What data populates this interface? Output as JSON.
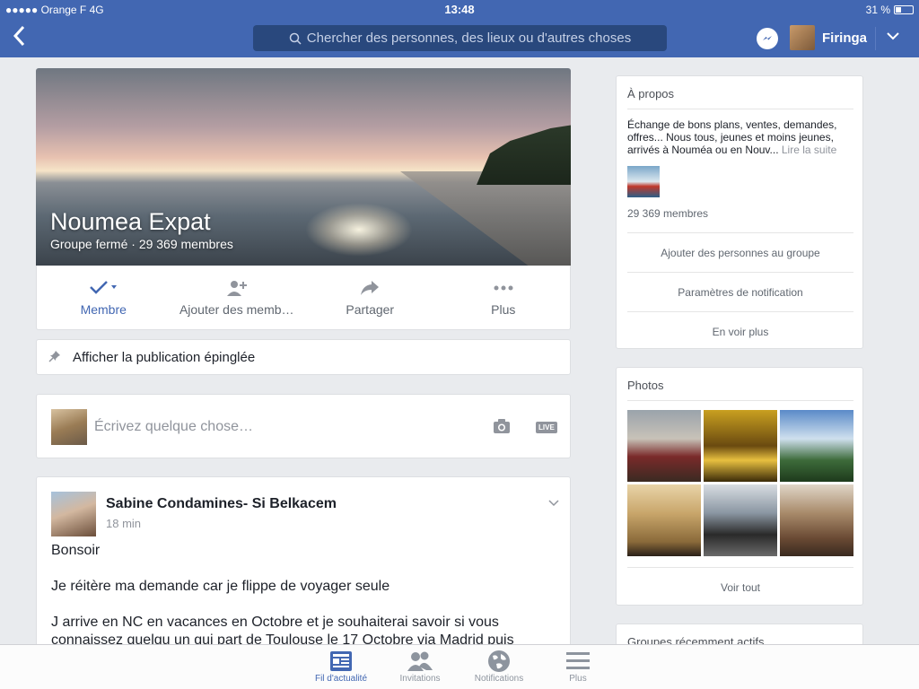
{
  "status": {
    "carrier": "●●●●● Orange F  4G",
    "time": "13:48",
    "battery": "31 %"
  },
  "header": {
    "search_placeholder": "Chercher des personnes, des lieux ou d'autres choses",
    "username": "Firinga"
  },
  "group": {
    "name": "Noumea Expat",
    "subtitle": "Groupe fermé · 29 369 membres",
    "actions": [
      {
        "label": "Membre",
        "icon": "check-icon",
        "active": true
      },
      {
        "label": "Ajouter des memb…",
        "icon": "add-person-icon"
      },
      {
        "label": "Partager",
        "icon": "share-icon"
      },
      {
        "label": "Plus",
        "icon": "more-icon"
      }
    ],
    "pinned_label": "Afficher la publication épinglée",
    "composer_placeholder": "Écrivez quelque chose…",
    "live_label": "LIVE"
  },
  "post": {
    "author": "Sabine Condamines- Si Belkacem",
    "time": "18 min",
    "paragraphs": [
      "Bonsoir",
      "Je réitère ma demande car je flippe de voyager seule",
      "J arrive en NC en vacances en Octobre et je souhaiterai savoir si vous connaissez quelqu un qui part de Toulouse le 17 Octobre via Madrid puis"
    ]
  },
  "about": {
    "heading": "À propos",
    "description": "Échange de bons plans, ventes, demandes, offres... Nous tous, jeunes et moins jeunes, arrivés à Nouméa ou en Nouv...",
    "read_more": "Lire la suite",
    "members": "29 369 membres",
    "links": [
      "Ajouter des personnes au groupe",
      "Paramètres de notification",
      "En voir plus"
    ]
  },
  "photos": {
    "heading": "Photos",
    "see_all": "Voir tout",
    "tiles": [
      "#5a4a40",
      "#8a6a1a",
      "#3d6b3a",
      "#c9a66b",
      "#4e5a66",
      "#7a5a44"
    ]
  },
  "recent": {
    "heading": "Groupes récemment actifs"
  },
  "tabs": [
    {
      "label": "Fil d'actualité",
      "icon": "news-feed-icon",
      "active": true
    },
    {
      "label": "Invitations",
      "icon": "friends-icon"
    },
    {
      "label": "Notifications",
      "icon": "globe-icon"
    },
    {
      "label": "Plus",
      "icon": "menu-icon"
    }
  ],
  "colors": {
    "brand": "#4267b2",
    "background": "#e9ebee"
  }
}
